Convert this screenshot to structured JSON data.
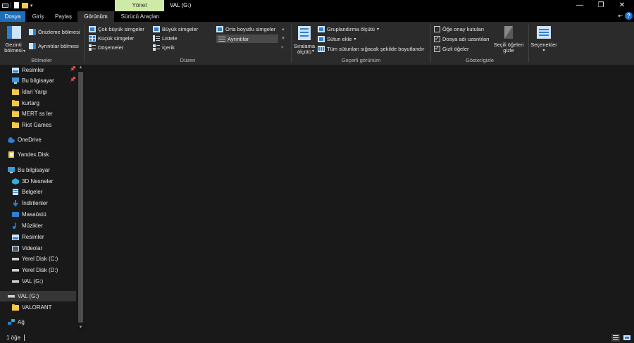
{
  "title_bar": {
    "context_tab": "Yönet",
    "window_title": "VAL (G:)",
    "buttons": {
      "minimize": "—",
      "restore": "❐",
      "close": "✕"
    }
  },
  "tabs": [
    {
      "label": "Dosya"
    },
    {
      "label": "Giriş"
    },
    {
      "label": "Paylaş"
    },
    {
      "label": "Görünüm"
    },
    {
      "label": "Sürücü Araçları"
    }
  ],
  "tabrow_right": {
    "expand": "⇤",
    "help": "?"
  },
  "ribbon": {
    "panes": {
      "nav_pane": "Gezinti bölmesi",
      "preview_pane": "Önizleme bölmesi",
      "details_pane": "Ayrıntılar bölmesi",
      "group_label": "Bölmeler"
    },
    "layout": {
      "items": [
        "Çok büyük simgeler",
        "Büyük simgeler",
        "Orta boyutlu simgeler",
        "Küçük simgeler",
        "Listele",
        "Ayrıntılar",
        "Döşemeler",
        "İçerik"
      ],
      "group_label": "Düzen"
    },
    "current_view": {
      "sort_by": "Sıralama ölçütü",
      "group_by": "Gruplandırma ölçütü",
      "add_columns": "Sütun ekle",
      "fit_columns": "Tüm sütunları sığacak şekilde boyutlandır",
      "group_label": "Geçerli görünüm"
    },
    "show_hide": {
      "item_checkboxes": "Öğe onay kutuları",
      "file_extensions": "Dosya adı uzantıları",
      "hidden_items": "Gizli öğeler",
      "hide_selected": "Seçili öğeleri gizle",
      "group_label": "Göster/gizle",
      "checked": {
        "item_checkboxes": false,
        "file_extensions": true,
        "hidden_items": true
      }
    },
    "options": "Seçenekler"
  },
  "nav": {
    "items": [
      "Resimler",
      "Bu bilgisayar",
      "İdari Yargı",
      "kurtarg",
      "MERT ss ler",
      "Riot Games",
      "OneDrive",
      "Yandex.Disk",
      "Bu bilgisayar",
      "3D Nesneler",
      "Belgeler",
      "İndirilenler",
      "Masaüstü",
      "Müzikler",
      "Resimler",
      "Videolar",
      "Yerel Disk (C:)",
      "Yerel Disk (D:)",
      "VAL (G:)",
      "VAL (G:)",
      "VALORANT",
      "Ağ"
    ]
  },
  "status": {
    "item_count": "1 öğe"
  },
  "colors": {
    "file_tab": "#1e6eb6",
    "context_tab": "#cfe9a6",
    "background": "#191919",
    "ribbon": "#2b2b2b"
  }
}
